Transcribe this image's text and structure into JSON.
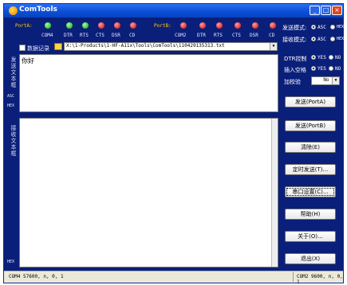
{
  "window": {
    "title": "ComTools"
  },
  "title_buttons": {
    "min": "_",
    "max": "□",
    "close": "×"
  },
  "portA": {
    "label": "PortA:",
    "port": "COM4",
    "signals": [
      {
        "name": "DTR",
        "state": "green"
      },
      {
        "name": "RTS",
        "state": "green"
      },
      {
        "name": "CTS",
        "state": "red"
      },
      {
        "name": "DSR",
        "state": "red"
      },
      {
        "name": "CD",
        "state": "red"
      }
    ],
    "port_led": "green"
  },
  "portB": {
    "label": "PortB:",
    "port": "COM2",
    "signals": [
      {
        "name": "DTR",
        "state": "red"
      },
      {
        "name": "RTS",
        "state": "red"
      },
      {
        "name": "CTS",
        "state": "red"
      },
      {
        "name": "DSR",
        "state": "red"
      },
      {
        "name": "CD",
        "state": "red"
      }
    ],
    "port_led": "red"
  },
  "record": {
    "label": "数据记录",
    "path": "X:\\1-Products\\1-HF-A11x\\Tools\\ComTools\\110429135313.txt"
  },
  "send_box": {
    "vlabel": "发送文本框",
    "text": "你好",
    "asc_label": "ASC",
    "hex_label": "HEX"
  },
  "recv_box": {
    "vlabel": "接收文本框",
    "hex_label": "HEX"
  },
  "options": {
    "send_mode_label": "发送模式:",
    "recv_mode_label": "接收模式:",
    "asc": "ASC",
    "hex": "HEX",
    "dtr_label": "DTR控制",
    "insert_space_label": "插入空格",
    "yes": "YES",
    "no": "NO",
    "checksum_label": "加校验",
    "checksum_value": "No"
  },
  "buttons": {
    "send_a": "发送(PortA)",
    "send_b": "发送(PortB)",
    "clear": "清除(E)",
    "timer_send": "定时发送(T)...",
    "port_settings": "串口设置(C)...",
    "help": "帮助(H)",
    "about": "关于(O)...",
    "exit": "退出(X)"
  },
  "status": {
    "left": "COM4 57600, n, 0, 1",
    "right": "COM2 9600, n, 0, 1"
  }
}
